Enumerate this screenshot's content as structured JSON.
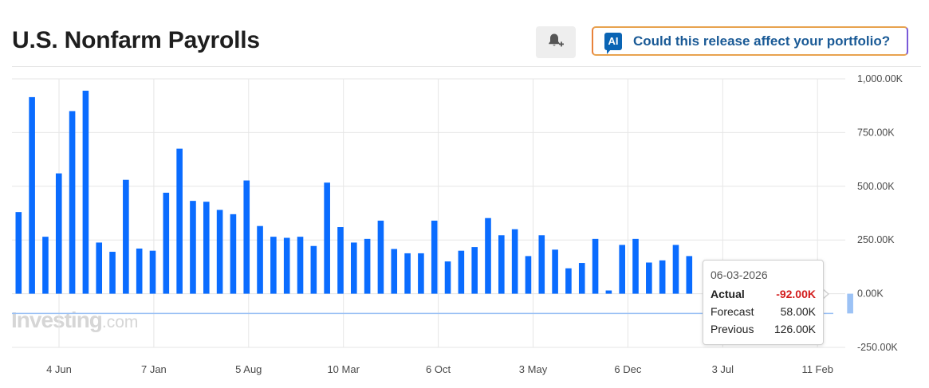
{
  "header": {
    "title": "U.S. Nonfarm Payrolls",
    "alert_icon": "bell-plus-icon",
    "ai_badge": "AI",
    "ai_button_label": "Could this release affect your portfolio?"
  },
  "colors": {
    "bar": "#0a6cff",
    "bar_highlight": "#9cc2f5",
    "grid": "#e6e6e6",
    "axis_text": "#4a4a4a",
    "negative": "#d31c1c",
    "accent_border": "#e8a24e"
  },
  "watermark": {
    "brand": "Investing",
    "suffix": ".com"
  },
  "tooltip": {
    "date": "06-03-2026",
    "actual_label": "Actual",
    "actual_value": "-92.00K",
    "forecast_label": "Forecast",
    "forecast_value": "58.00K",
    "previous_label": "Previous",
    "previous_value": "126.00K"
  },
  "chart_data": {
    "type": "bar",
    "title": "U.S. Nonfarm Payrolls",
    "xlabel": "",
    "ylabel": "",
    "ylim": [
      -250,
      1000
    ],
    "yticks": [
      {
        "value": 1000,
        "label": "1,000.00K"
      },
      {
        "value": 750,
        "label": "750.00K"
      },
      {
        "value": 500,
        "label": "500.00K"
      },
      {
        "value": 250,
        "label": "250.00K"
      },
      {
        "value": 0,
        "label": "0.00K"
      },
      {
        "value": -250,
        "label": "-250.00K"
      }
    ],
    "xticks": [
      "4 Jun",
      "7 Jan",
      "5 Aug",
      "10 Mar",
      "6 Oct",
      "3 May",
      "6 Dec",
      "3 Jul",
      "11 Feb"
    ],
    "grid": true,
    "values": [
      380,
      915,
      265,
      560,
      850,
      945,
      238,
      195,
      530,
      210,
      200,
      470,
      675,
      432,
      428,
      390,
      370,
      527,
      315,
      265,
      260,
      265,
      222,
      517,
      310,
      238,
      255,
      340,
      208,
      188,
      188,
      340,
      150,
      200,
      217,
      352,
      272,
      300,
      175,
      272,
      205,
      118,
      143,
      255,
      15,
      227,
      255,
      145,
      155,
      227,
      175,
      null,
      null,
      null,
      null,
      null,
      null,
      null,
      null,
      null,
      null,
      null,
      -92
    ],
    "highlight_index": 62,
    "reference_line": {
      "value": -92,
      "label": "Actual"
    }
  }
}
